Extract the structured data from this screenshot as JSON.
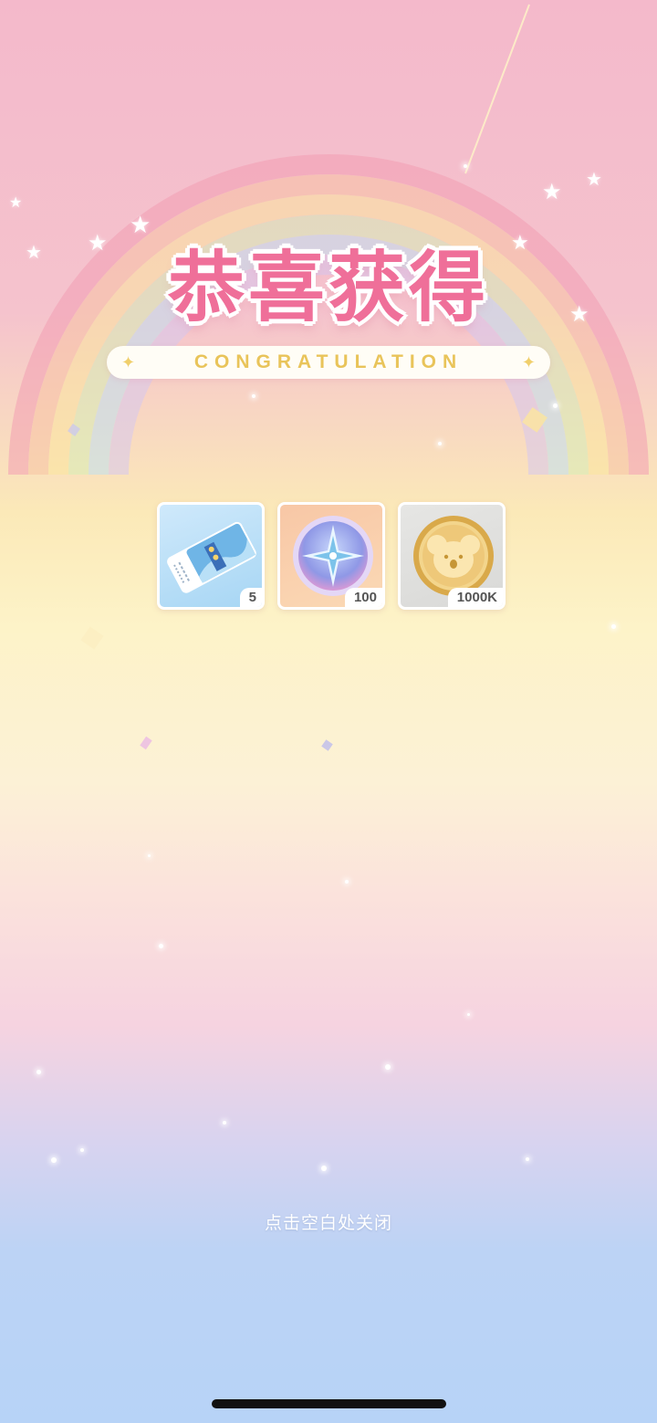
{
  "dialog": {
    "title": "恭喜获得",
    "subtitle": "CONGRATULATION",
    "close_hint": "点击空白处关闭"
  },
  "rewards": [
    {
      "icon": "ticket-icon",
      "quantity": "5"
    },
    {
      "icon": "compass-star-badge-icon",
      "quantity": "100"
    },
    {
      "icon": "gold-koala-coin-icon",
      "quantity": "1000K"
    }
  ],
  "colors": {
    "title_pink": "#ef6f99",
    "subtitle_gold": "#e9c45a",
    "hint_white": "#ffffff"
  }
}
